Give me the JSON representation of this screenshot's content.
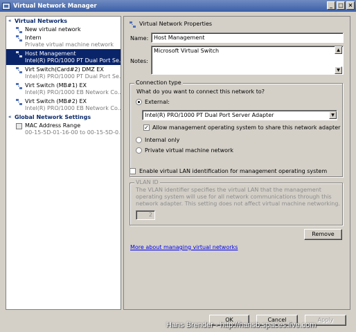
{
  "window": {
    "title": "Virtual Network Manager"
  },
  "sidebar": {
    "virtual_networks_header": "Virtual Networks",
    "global_settings_header": "Global Network Settings",
    "networks": [
      {
        "name": "New virtual network",
        "detail": ""
      },
      {
        "name": "Intern",
        "detail": "Private virtual machine network"
      },
      {
        "name": "Host Management",
        "detail": "Intel(R) PRO/1000 PT Dual Port Se..."
      },
      {
        "name": "Virt Switch(Card#2) DMZ EX",
        "detail": "Intel(R) PRO/1000 PT Dual Port Se..."
      },
      {
        "name": "Virt Switch (MB#1) EX",
        "detail": "Intel(R) PRO/1000 EB Network Co..."
      },
      {
        "name": "Virt Switch (MB#2) EX",
        "detail": "Intel(R) PRO/1000 EB Network Co..."
      }
    ],
    "mac_range": {
      "name": "MAC Address Range",
      "detail": "00-15-5D-01-16-00 to 00-15-5D-0..."
    }
  },
  "props": {
    "header": "Virtual Network Properties",
    "name_label": "Name:",
    "name_value": "Host Management",
    "notes_label": "Notes:",
    "notes_value": "Microsoft Virtual Switch"
  },
  "connection": {
    "legend": "Connection type",
    "question": "What do you want to connect this network to?",
    "external_label": "External:",
    "adapter_value": "Intel(R) PRO/1000 PT Dual Port Server Adapter",
    "allow_mgmt_label": "Allow management operating system to share this network adapter",
    "internal_label": "Internal only",
    "private_label": "Private virtual machine network",
    "selected": "External"
  },
  "vlan": {
    "enable_label": "Enable virtual LAN identification for management operating system",
    "legend": "VLAN ID",
    "description": "The VLAN identifier specifies the virtual LAN that the management operating system will use for all network communications through this network adapter. This setting does not affect virtual machine networking.",
    "value": "2"
  },
  "actions": {
    "remove_label": "Remove",
    "more_link": "More about managing virtual networks",
    "ok_label": "OK",
    "cancel_label": "Cancel",
    "apply_label": "Apply"
  },
  "watermark": "Hans Brender - http://hansb.spaces.live.com",
  "colors": {
    "selection": "#0a246a",
    "link": "#0000ee",
    "dialog_bg": "#d4d0c8"
  }
}
